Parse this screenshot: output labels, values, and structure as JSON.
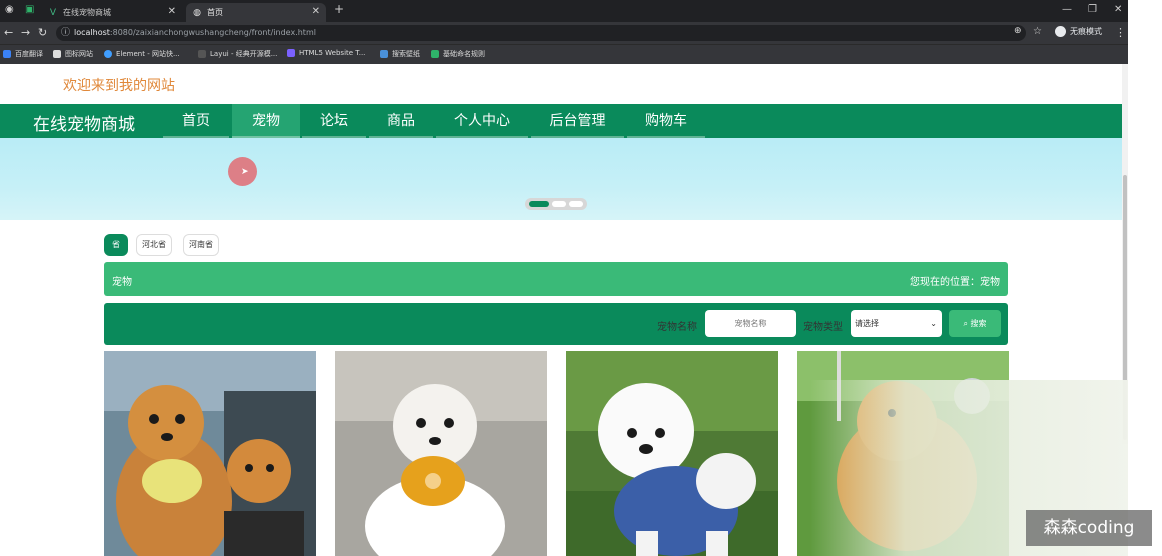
{
  "browser": {
    "tabs": [
      {
        "label": "在线宠物商城",
        "active": false
      },
      {
        "label": "首页",
        "active": true
      }
    ],
    "new_tab": "+",
    "url_host": "localhost",
    "url_rest": ":8080/zaixianchongwushangcheng/front/index.html",
    "incognito_label": "无痕模式",
    "bookmarks": [
      "百度翻译",
      "图标网站",
      "Element - 网站快...",
      "Layui - 经典开源模...",
      "HTML5 Website T...",
      "搜索壁纸",
      "基础命名规则"
    ]
  },
  "header": {
    "welcome": "欢迎来到我的网站",
    "brand": "在线宠物商城",
    "nav": [
      "首页",
      "宠物",
      "论坛",
      "商品",
      "个人中心",
      "后台管理",
      "购物车"
    ],
    "active_nav": "宠物"
  },
  "filters": {
    "areas": [
      "省",
      "河北省",
      "河南省"
    ],
    "active_area": "省"
  },
  "breadcrumb": {
    "title": "宠物",
    "location": "您现在的位置：宠物"
  },
  "search": {
    "name_label": "宠物名称",
    "name_placeholder": "宠物名称",
    "type_label": "宠物类型",
    "type_value": "请选择",
    "button": "搜索"
  },
  "watermark": "森森coding",
  "colors": {
    "primary": "#0a8a5b",
    "accent": "#3aba78",
    "welcome": "#e0883a"
  }
}
